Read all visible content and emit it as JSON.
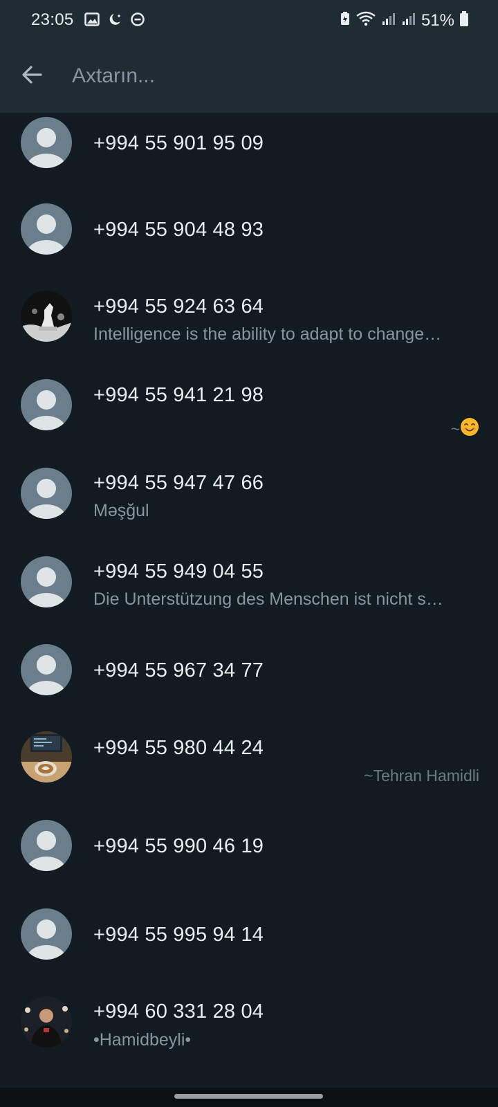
{
  "status": {
    "time": "23:05",
    "battery": "51%"
  },
  "search": {
    "placeholder": "Axtarın..."
  },
  "contacts": [
    {
      "name": "+994 55 901 95 09",
      "about": "",
      "pushname": ""
    },
    {
      "name": "+994 55 904 48 93",
      "about": "",
      "pushname": ""
    },
    {
      "name": "+994 55 924 63 64",
      "about": "Intelligence is the ability to adapt to change…",
      "pushname": ""
    },
    {
      "name": "+994 55 941 21 98",
      "about": "",
      "pushname": "~"
    },
    {
      "name": "+994 55 947 47 66",
      "about": "Məşğul",
      "pushname": ""
    },
    {
      "name": "+994 55 949 04 55",
      "about": "Die Unterstützung des Menschen ist nicht s…",
      "pushname": ""
    },
    {
      "name": "+994 55 967 34 77",
      "about": "",
      "pushname": ""
    },
    {
      "name": "+994 55 980 44 24",
      "about": "",
      "pushname": "~Tehran Hamidli"
    },
    {
      "name": "+994 55 990 46 19",
      "about": "",
      "pushname": ""
    },
    {
      "name": "+994 55 995 94 14",
      "about": "",
      "pushname": ""
    },
    {
      "name": "+994 60 331 28 04",
      "about": "•Hamidbeyli•",
      "pushname": ""
    }
  ],
  "icons": {
    "back": "arrow-left-icon",
    "avatar_default": "default-avatar-icon",
    "emoji": "smiling-face-emoji"
  },
  "colors": {
    "background": "#111b21",
    "header": "#202c33",
    "secondary_text": "#8696a0"
  }
}
